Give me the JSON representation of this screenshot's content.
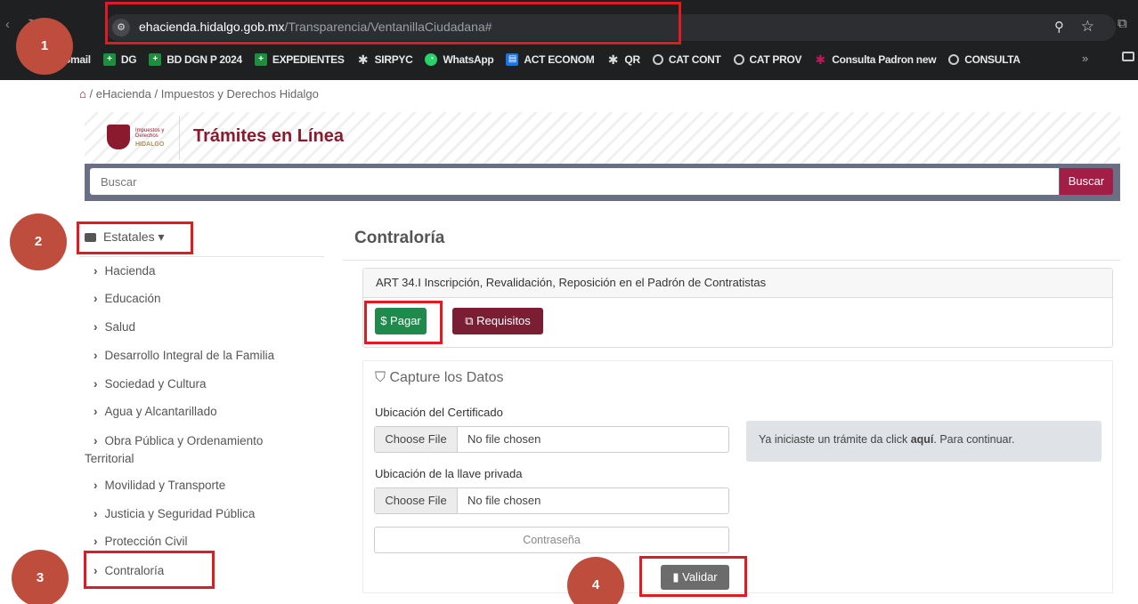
{
  "browser": {
    "url_domain": "ehacienda.hidalgo.gob.mx",
    "url_path": "/Transparencia/VentanillaCiudadana#",
    "bookmarks": [
      {
        "label": "Gmail",
        "icon": "gmail-icon"
      },
      {
        "label": "DG",
        "icon": "sheets-icon"
      },
      {
        "label": "BD DGN P 2024",
        "icon": "sheets-icon"
      },
      {
        "label": "EXPEDIENTES",
        "icon": "sheets-icon"
      },
      {
        "label": "SIRPYC",
        "icon": "puzzle-icon"
      },
      {
        "label": "WhatsApp",
        "icon": "whatsapp-icon"
      },
      {
        "label": "ACT ECONOM",
        "icon": "doc-icon"
      },
      {
        "label": "QR",
        "icon": "puzzle-icon"
      },
      {
        "label": "CAT CONT",
        "icon": "globe-icon"
      },
      {
        "label": "CAT PROV",
        "icon": "globe-icon"
      },
      {
        "label": "Consulta Padron new",
        "icon": "puzzle-icon"
      },
      {
        "label": "CONSULTA",
        "icon": "globe-icon"
      }
    ],
    "more": "»"
  },
  "annotations": {
    "n1": "1",
    "n2": "2",
    "n3": "3",
    "n4": "4"
  },
  "breadcrumb": {
    "sep1": "/",
    "item1": "eHacienda",
    "sep2": "/",
    "item2": "Impuestos y Derechos Hidalgo"
  },
  "header": {
    "logo_small": "Impuestos y Derechos",
    "logo_hidalgo": "HIDALGO",
    "title": "Trámites en Línea"
  },
  "search": {
    "placeholder": "Buscar",
    "button": "Buscar"
  },
  "sidebar": {
    "dropdown": "Estatales",
    "items": [
      {
        "label": "Hacienda"
      },
      {
        "label": "Educación"
      },
      {
        "label": "Salud"
      },
      {
        "label": "Desarrollo Integral de la Familia"
      },
      {
        "label": "Sociedad y Cultura"
      },
      {
        "label": "Agua y Alcantarillado"
      },
      {
        "label": "Obra Pública y Ordenamiento"
      },
      {
        "label": "Movilidad y Transporte"
      },
      {
        "label": "Justicia y Seguridad Pública"
      },
      {
        "label": "Protección Civil"
      },
      {
        "label": "Contraloría"
      }
    ],
    "item6_line2": "Territorial"
  },
  "main": {
    "title": "Contraloría",
    "tramite": "ART 34.I Inscripción, Revalidación, Reposición en el Padrón de Contratistas",
    "pagar": "$ Pagar",
    "requisitos": "Requisitos",
    "capture_title": "Capture los Datos",
    "cert_label": "Ubicación del Certificado",
    "key_label": "Ubicación de la llave privada",
    "choose_file": "Choose File",
    "no_file": "No file chosen",
    "info_pre": "Ya iniciaste un trámite da click ",
    "info_link": "aquí",
    "info_post": ". Para continuar.",
    "password_placeholder": "Contraseña",
    "validar": "Validar"
  }
}
